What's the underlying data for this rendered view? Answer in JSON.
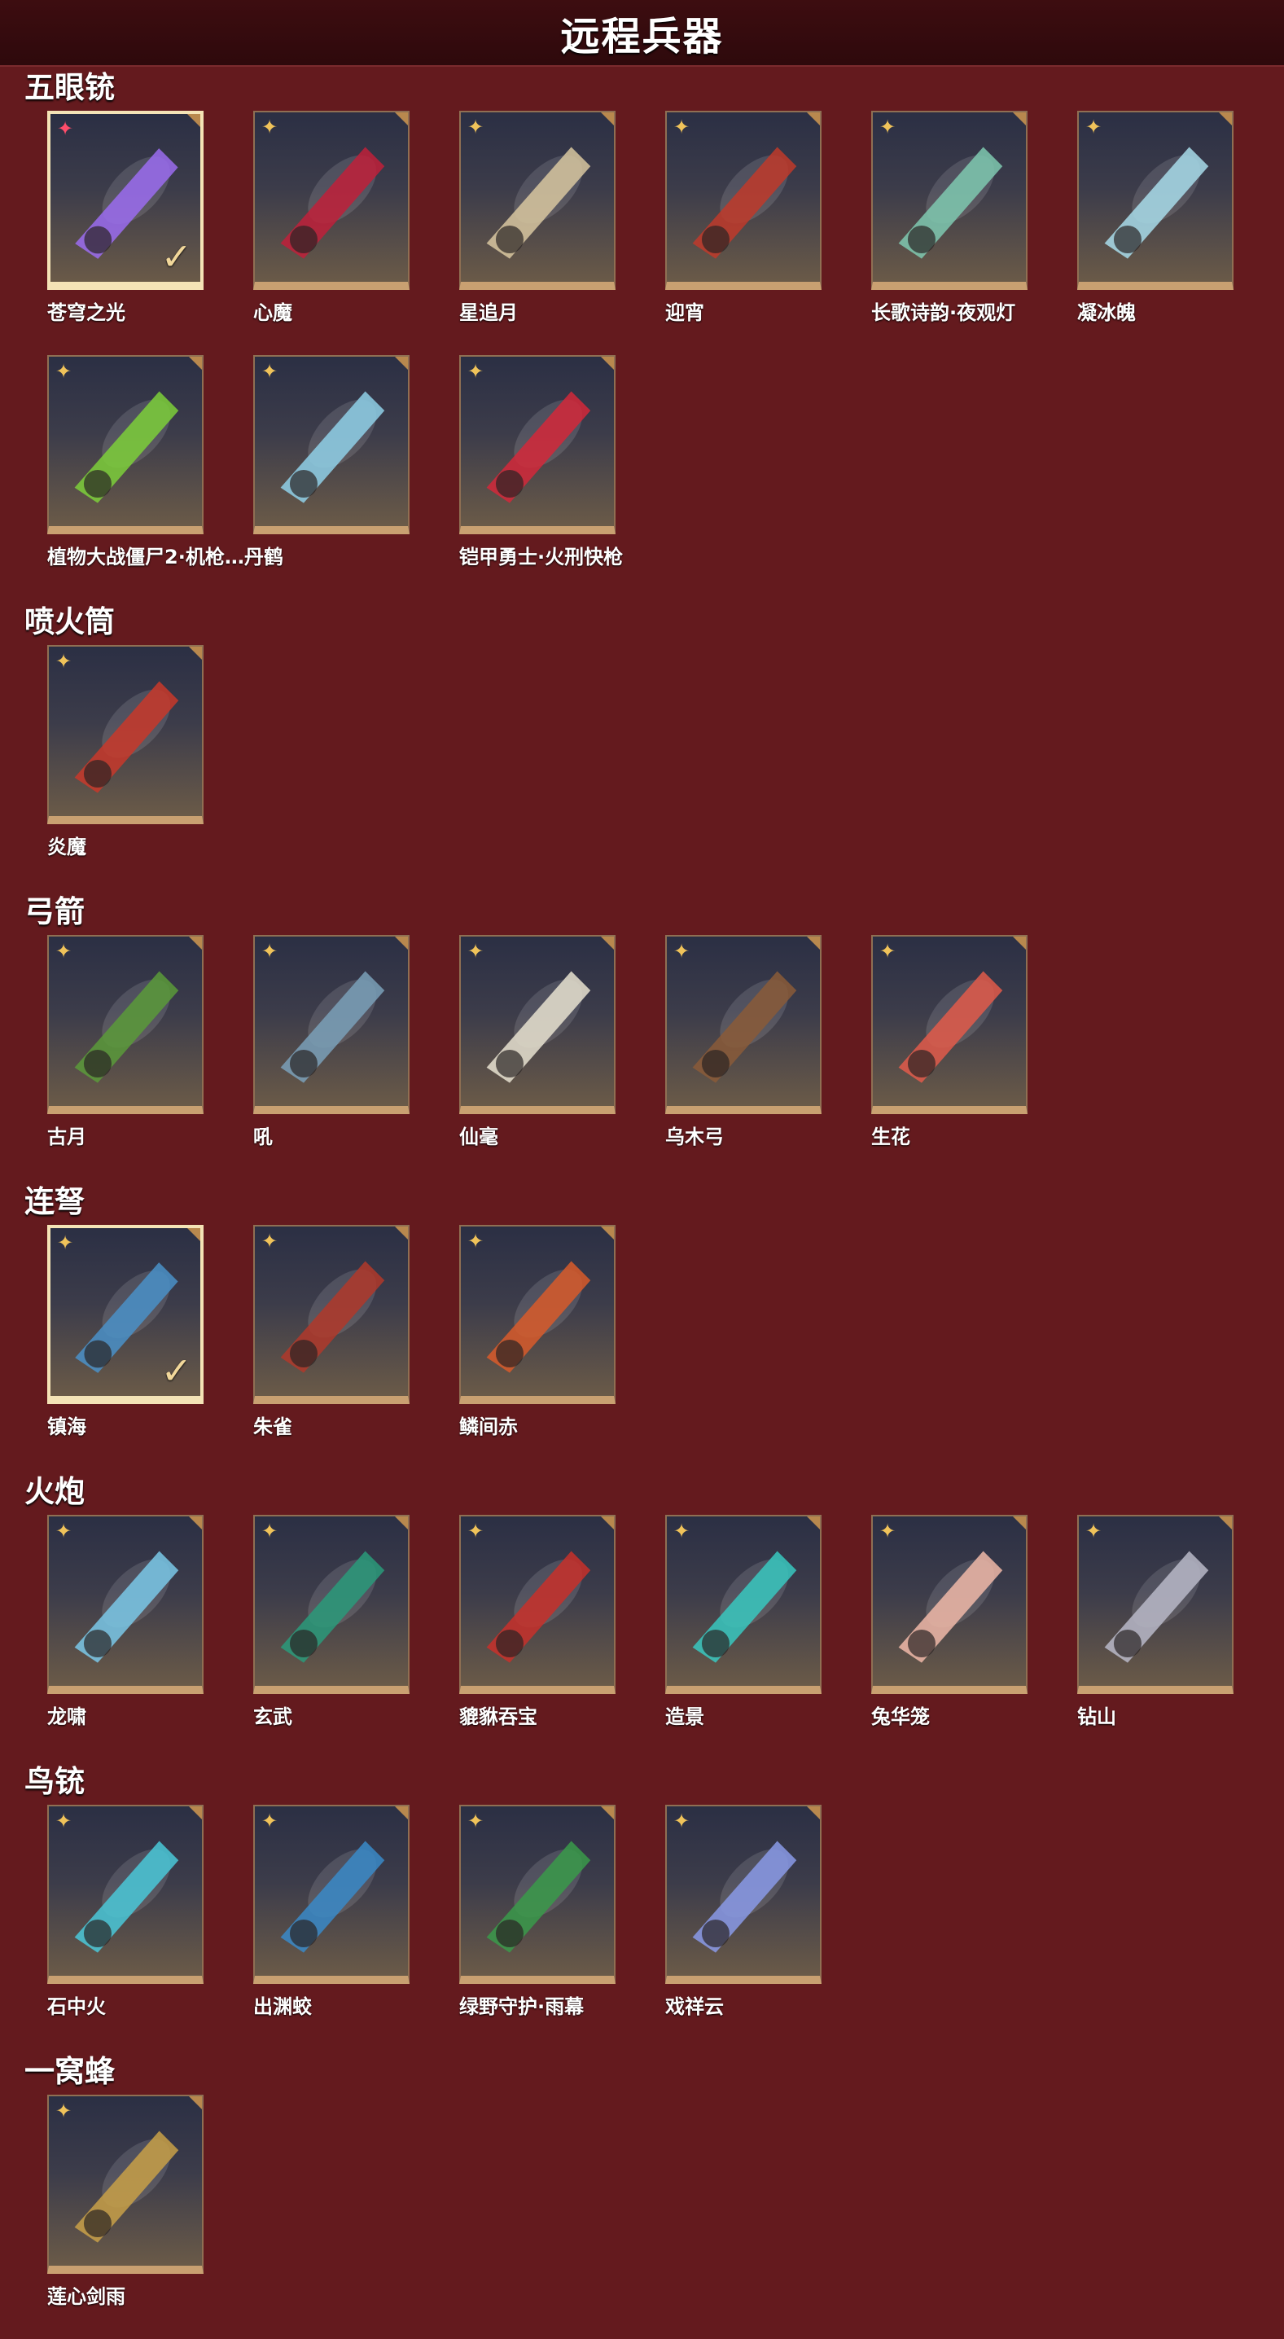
{
  "header": {
    "title": "远程兵器"
  },
  "sections": [
    {
      "title": "五眼铳",
      "items": [
        {
          "name": "苍穹之光",
          "selected": true,
          "rarity_color": "red",
          "accent": "#9b6cf0"
        },
        {
          "name": "心魔",
          "selected": false,
          "rarity_color": "gold",
          "accent": "#c0203a"
        },
        {
          "name": "星追月",
          "selected": false,
          "rarity_color": "gold",
          "accent": "#d8c7a0"
        },
        {
          "name": "迎宵",
          "selected": false,
          "rarity_color": "gold",
          "accent": "#c03a2a"
        },
        {
          "name": "长歌诗韵·夜观灯",
          "selected": false,
          "rarity_color": "gold",
          "accent": "#7fc9b0"
        },
        {
          "name": "凝冰魄",
          "selected": false,
          "rarity_color": "gold",
          "accent": "#a8dcea"
        },
        {
          "name": "植物大战僵尸2·机枪…丹鹤",
          "selected": false,
          "rarity_color": "gold",
          "accent": "#7ccf3a"
        },
        {
          "name": "",
          "selected": false,
          "rarity_color": "gold",
          "accent": "#8fd0e8"
        },
        {
          "name": "铠甲勇士·火刑快枪",
          "selected": false,
          "rarity_color": "gold",
          "accent": "#d4283a"
        }
      ]
    },
    {
      "title": "喷火筒",
      "items": [
        {
          "name": "炎魔",
          "selected": false,
          "rarity_color": "gold",
          "accent": "#c8382a"
        }
      ]
    },
    {
      "title": "弓箭",
      "items": [
        {
          "name": "古月",
          "selected": false,
          "rarity_color": "gold",
          "accent": "#5a9a3a"
        },
        {
          "name": "吼",
          "selected": false,
          "rarity_color": "gold",
          "accent": "#7aa0b8"
        },
        {
          "name": "仙毫",
          "selected": false,
          "rarity_color": "gold",
          "accent": "#e8e2d0"
        },
        {
          "name": "乌木弓",
          "selected": false,
          "rarity_color": "gold",
          "accent": "#8a5a38"
        },
        {
          "name": "生花",
          "selected": false,
          "rarity_color": "gold",
          "accent": "#e25a4a"
        }
      ]
    },
    {
      "title": "连弩",
      "items": [
        {
          "name": "镇海",
          "selected": true,
          "rarity_color": "gold",
          "accent": "#4a90c8"
        },
        {
          "name": "朱雀",
          "selected": false,
          "rarity_color": "gold",
          "accent": "#b0382a"
        },
        {
          "name": "鳞间赤",
          "selected": false,
          "rarity_color": "gold",
          "accent": "#d85a2a"
        }
      ]
    },
    {
      "title": "火炮",
      "items": [
        {
          "name": "龙啸",
          "selected": false,
          "rarity_color": "gold",
          "accent": "#7ac8e8"
        },
        {
          "name": "玄武",
          "selected": false,
          "rarity_color": "gold",
          "accent": "#2a9a7a"
        },
        {
          "name": "貔貅吞宝",
          "selected": false,
          "rarity_color": "gold",
          "accent": "#c8302a"
        },
        {
          "name": "造景",
          "selected": false,
          "rarity_color": "gold",
          "accent": "#38c8c0"
        },
        {
          "name": "兔华笼",
          "selected": false,
          "rarity_color": "gold",
          "accent": "#f0b8a8"
        },
        {
          "name": "钻山",
          "selected": false,
          "rarity_color": "gold",
          "accent": "#b8b8c8"
        }
      ]
    },
    {
      "title": "鸟铳",
      "items": [
        {
          "name": "石中火",
          "selected": false,
          "rarity_color": "gold",
          "accent": "#4ac8d8"
        },
        {
          "name": "出渊蛟",
          "selected": false,
          "rarity_color": "gold",
          "accent": "#3a8ac8"
        },
        {
          "name": "绿野守护·雨幕",
          "selected": false,
          "rarity_color": "gold",
          "accent": "#3a9a4a"
        },
        {
          "name": "戏祥云",
          "selected": false,
          "rarity_color": "gold",
          "accent": "#8a9ae8"
        }
      ]
    },
    {
      "title": "一窝蜂",
      "items": [
        {
          "name": "莲心剑雨",
          "selected": false,
          "rarity_color": "gold",
          "accent": "#c8a048"
        }
      ]
    }
  ]
}
